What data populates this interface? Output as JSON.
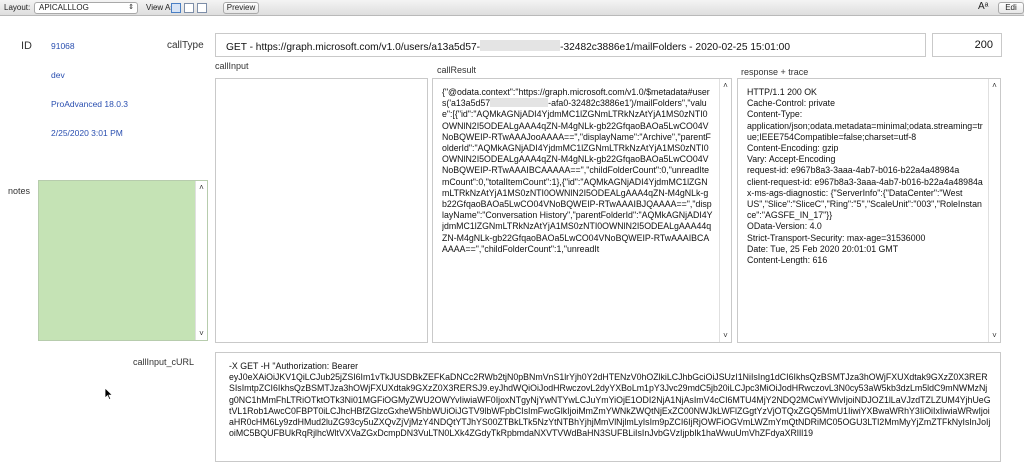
{
  "toolbar": {
    "layout_label": "Layout:",
    "layout_value": "APICALLLOG",
    "view_as_label": "View As:",
    "preview_label": "Preview",
    "right_icon": "text-size-icon",
    "edit_label": "Edi"
  },
  "record": {
    "id_label": "ID",
    "id_value": "91068",
    "env_value": "dev",
    "product_value": "ProAdvanced 18.0.3",
    "datetime_value": "2/25/2020 3:01 PM",
    "notes_label": "notes",
    "calltype_label": "callType",
    "calltype_prefix": "GET - https://graph.microsoft.com/v1.0/users/a13a5d57-",
    "calltype_suffix": "-32482c3886e1/mailFolders - 2020-02-25 15:01:00",
    "status_value": "200",
    "callinput_label": "callInput",
    "callresult_label": "callResult",
    "response_label": "response + trace",
    "curl_label": "callInput_cURL"
  },
  "callresult": {
    "part1": "{\"@odata.context\":\"https://graph.microsoft.com/v1.0/$metadata#users('a13a5d57",
    "part2": "-afa0-32482c3886e1')/mailFolders\",\"value\":[{\"id\":\"AQMkAGNjADI4YjdmMC1lZGNmLTRkNzAtYjA1MS0zNTI0OWNlN2I5ODEALgAAA4qZN-M4gNLk-gb22GfqaoBAOa5LwCO04VNoBQWEIP-RTwAAAJooAAAA==\",\"displayName\":\"Archive\",\"parentFolderId\":\"AQMkAGNjADI4YjdmMC1lZGNmLTRkNzAtYjA1MS0zNTI0OWNlN2I5ODEALgAAA4qZN-M4gNLk-gb22GfqaoBAOa5LwCO04VNoBQWEIP-RTwAAAIBCAAAAA==\",\"childFolderCount\":0,\"unreadItemCount\":0,\"totalItemCount\":1},{\"id\":\"AQMkAGNjADI4YjdmMC1lZGNmLTRkNzAtYjA1MS0zNTI0OWNlN2I5ODEALgAAA4qZN-M4gNLk-gb22GfqaoBAOa5LwCO04VNoBQWEIP-RTwAAAIBJQAAAA==\",\"displayName\":\"Conversation History\",\"parentFolderId\":\"AQMkAGNjADI4YjdmMC1lZGNmLTRkNzAtYjA1MS0zNTI0OWNlN2I5ODEALgAAA44qZN-M4gNLk-gb22GfqaoBAOa5LwCO04VNoBQWEIP-RTwAAAIBCAAAAA==\",\"childFolderCount\":1,\"unreadIt"
  },
  "response": {
    "text": "HTTP/1.1 200 OK\nCache-Control: private\nContent-Type: application/json;odata.metadata=minimal;odata.streaming=true;IEEE754Compatible=false;charset=utf-8\nContent-Encoding: gzip\nVary: Accept-Encoding\nrequest-id: e967b8a3-3aaa-4ab7-b016-b22a4a48984a\nclient-request-id: e967b8a3-3aaa-4ab7-b016-b22a4a48984a\nx-ms-ags-diagnostic: {\"ServerInfo\":{\"DataCenter\":\"West US\",\"Slice\":\"SliceC\",\"Ring\":\"5\",\"ScaleUnit\":\"003\",\"RoleInstance\":\"AGSFE_IN_17\"}}\nOData-Version: 4.0\nStrict-Transport-Security: max-age=31536000\nDate: Tue, 25 Feb 2020 20:01:01 GMT\nContent-Length: 616"
  },
  "curl": {
    "text": "-X GET -H \"Authorization: Bearer\neyJ0eXAiOiJKV1QiLCJub25jZSI6Im1vTkJUSDBkZEFKaDNCc2RWb2tjN0pBNmVnS1lrYjh0Y2dHTENzV0hOZlkiLCJhbGciOiJSUzI1NiIsIng1dCI6IkhsQzBSMTJza3hOWjFXUXdtak9GXzZ0X3RERSIsImtpZCI6IkhsQzBSMTJza3hOWjFXUXdtak9GXzZ0X3RERSJ9.eyJhdWQiOiJodHRwczovL2dyYXBoLm1pY3Jvc29mdC5jb20iLCJpc3MiOiJodHRwczovL3N0cy53aW5kb3dzLm5ldC9mNWMzNjg0NC1hMmFhLTRiOTktOTk3Ni01MGFiOGMyZWU2OWYvIiwiaWF0IjoxNTgyNjYwNTYwLCJuYmYiOjE1ODI2NjA1NjAsImV4cCI6MTU4MjY2NDQ2MCwiYWlvIjoiNDJOZ1lLaVJzdTZLZUM4YjhUeGtVL1Rob1AwcC0FBPT0iLCJhcHBfZGlzcGxheW5hbWUiOiJGTV9lbWFpbCIsImFwcGlkIjoiMmZmYWNkZWQtNjExZC00NWJkLWFlZGgtYzVjOTQxZGQ5MmU1IiwiYXBwaWRhY3IiOiIxIiwiaWRwIjoiaHR0cHM6Ly9zdHMud2luZG93cy5uZXQvZjVjMzY4NDQtYTJhYS00ZTBkLTk5NzYtNTBhYjhjMmVlNjlmLyIsIm9pZCI6IjRjOWFiOGVmLWZmYmQtNDRiMC05OGU3LTI2MmMyYjZmZTFkNyIsInJoIjoiMC5BQUFBUkRqRjlhcWltVXVaZGxDcmpDN3VuLTN0LXk4ZGdyTkRpbmdaNXVTVWdBaHN3SUFBLiIsInJvbGVzIjpbIk1haWwuUmVhZFdyaXRlIl19"
  },
  "colors": {
    "notes_bg": "#c5e3b5",
    "link_blue": "#2a4fb0"
  }
}
